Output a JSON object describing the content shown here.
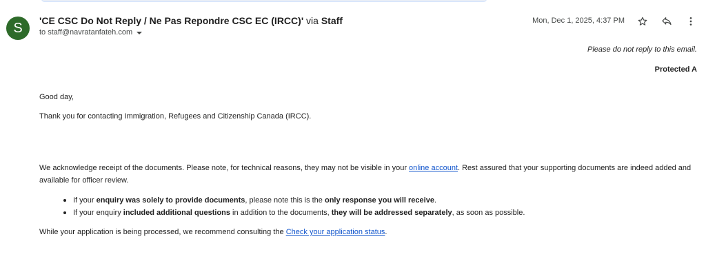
{
  "header": {
    "avatar_letter": "S",
    "sender": "'CE CSC Do Not Reply / Ne Pas Repondre CSC EC (IRCC)'",
    "via": "via",
    "via_name": "Staff",
    "to_prefix": "to",
    "to_address": "staff@navratanfateh.com",
    "date": "Mon, Dec 1, 2025, 4:37 PM",
    "icons": [
      "star-icon",
      "reply-icon",
      "more-vert-icon"
    ],
    "avatar_color": "#2e6b2a"
  },
  "message": {
    "no_reply_note": "Please do not reply to this email.",
    "classification": "Protected A",
    "greeting": "Good day,",
    "thanks": "Thank you for contacting Immigration, Refugees and Citizenship Canada (IRCC).",
    "ack_part1": "We acknowledge receipt of the documents. Please note, for technical reasons, they may not be visible in your ",
    "ack_link": "online account",
    "ack_part2": ". Rest assured that your supporting documents are indeed added and available for officer review.",
    "bullet1": {
      "t1": "If your ",
      "b1": "enquiry was solely to provide documents",
      "t2": ", please note this is the ",
      "b2": "only response you will receive",
      "t3": "."
    },
    "bullet2": {
      "t1": "If your enquiry ",
      "b1": "included additional questions",
      "t2": " in addition to the documents, ",
      "b2": "they will be addressed separately",
      "t3": ", as soon as possible."
    },
    "closing_part1": "While your application is being processed, we recommend consulting the ",
    "closing_link": "Check your application status",
    "closing_part2": "."
  }
}
